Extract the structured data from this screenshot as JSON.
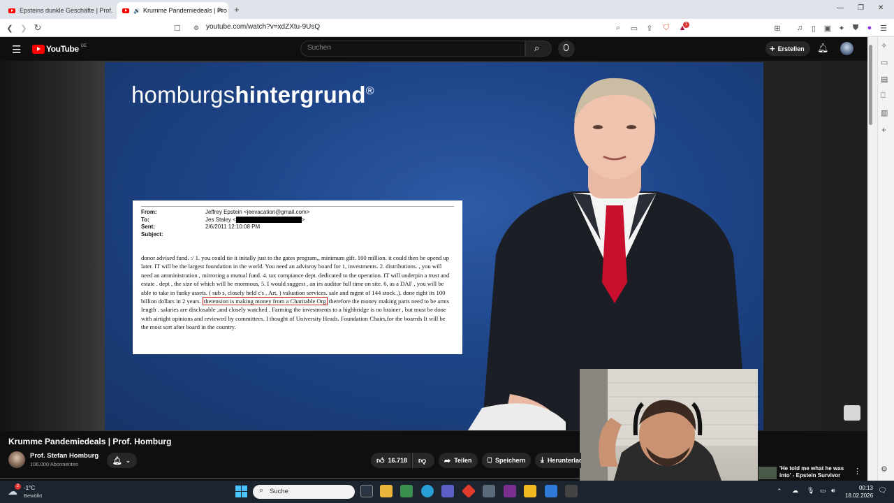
{
  "browser": {
    "tabs": [
      {
        "label": "Epsteins dunkle Geschäfte | Prof. Hom",
        "active": false
      },
      {
        "label": "Krumme Pandemiedeals | Pro",
        "active": true
      }
    ],
    "new_tab": "+",
    "url": "youtube.com/watch?v=xdZXtu-9UsQ",
    "window_controls": {
      "minimize": "—",
      "restore": "❐",
      "close": "✕"
    },
    "badge_count": "1"
  },
  "youtube": {
    "logo_text": "YouTube",
    "region": "DE",
    "search_placeholder": "Suchen",
    "create_label": "Erstellen"
  },
  "video_frame": {
    "brand_light": "homburgs",
    "brand_bold": "hintergrund",
    "brand_mark": "®",
    "email": {
      "from_label": "From:",
      "from_value": "Jeffrey Epstein <jeevacation@gmail.com>",
      "to_label": "To:",
      "to_value": "Jes Staley <",
      "to_suffix": ">",
      "sent_label": "Sent:",
      "sent_value": "2/6/2011 12:10:08 PM",
      "subject_label": "Subject:",
      "body_before": "donor advised fund.   :/   1. you could tie it initally just to the gates program,,  minimum gift.  100 million.  it could then be opend up later.   IT will be the largest foundation in the world.  You need an advisroy board for 1, investments. 2. distributions.  , you will need an amministration , mirroring a mutual fund.  4. tax compiance dept. dedicated to the operation.  IT will underpin a trust and estate . dept , the size of which will be enormous,  5. I would suggest , an irs auditor full time on site. 6, as a DAF , you will be able to take in funky assets. ( sub s, closely held c's , Art, ) valuation services.   sale and mgmt of 144 stock ,).   done right its 100 billion dollars in 2 years.   ",
      "body_highlight": "thetension is making money from a Charitable Org",
      "body_after": "  therefore the money making parts need to be arms length . salaries are disclosable ,and closely watched  . Farming the investments to a highbridge is no brainer , but must be done with airtight opinions and reviewed by committees.  I thought of University Heads. Foundation Chairs,for the boarrds  It will be the most sort after board in the country."
    }
  },
  "video_info": {
    "title": "Krumme Pandemiedeals | Prof. Homburg",
    "channel": "Prof. Stefan Homburg",
    "subscribers": "106.000 Abonnenten",
    "likes": "16.718",
    "share_label": "Teilen",
    "save_label": "Speichern",
    "download_label": "Herunterlad",
    "next_video_title": "'He told me what he was into' - Epstein Survivor"
  },
  "taskbar": {
    "weather_temp": "-1°C",
    "weather_desc": "Bewölkt",
    "weather_badge": "2",
    "search_label": "Suche",
    "time": "00:13",
    "date": "18.02.2026"
  },
  "colors": {
    "yt_red": "#ff0000",
    "yt_bg": "#0f0f0f",
    "studio_blue": "#1e4589",
    "highlight_red": "#cc2222"
  }
}
